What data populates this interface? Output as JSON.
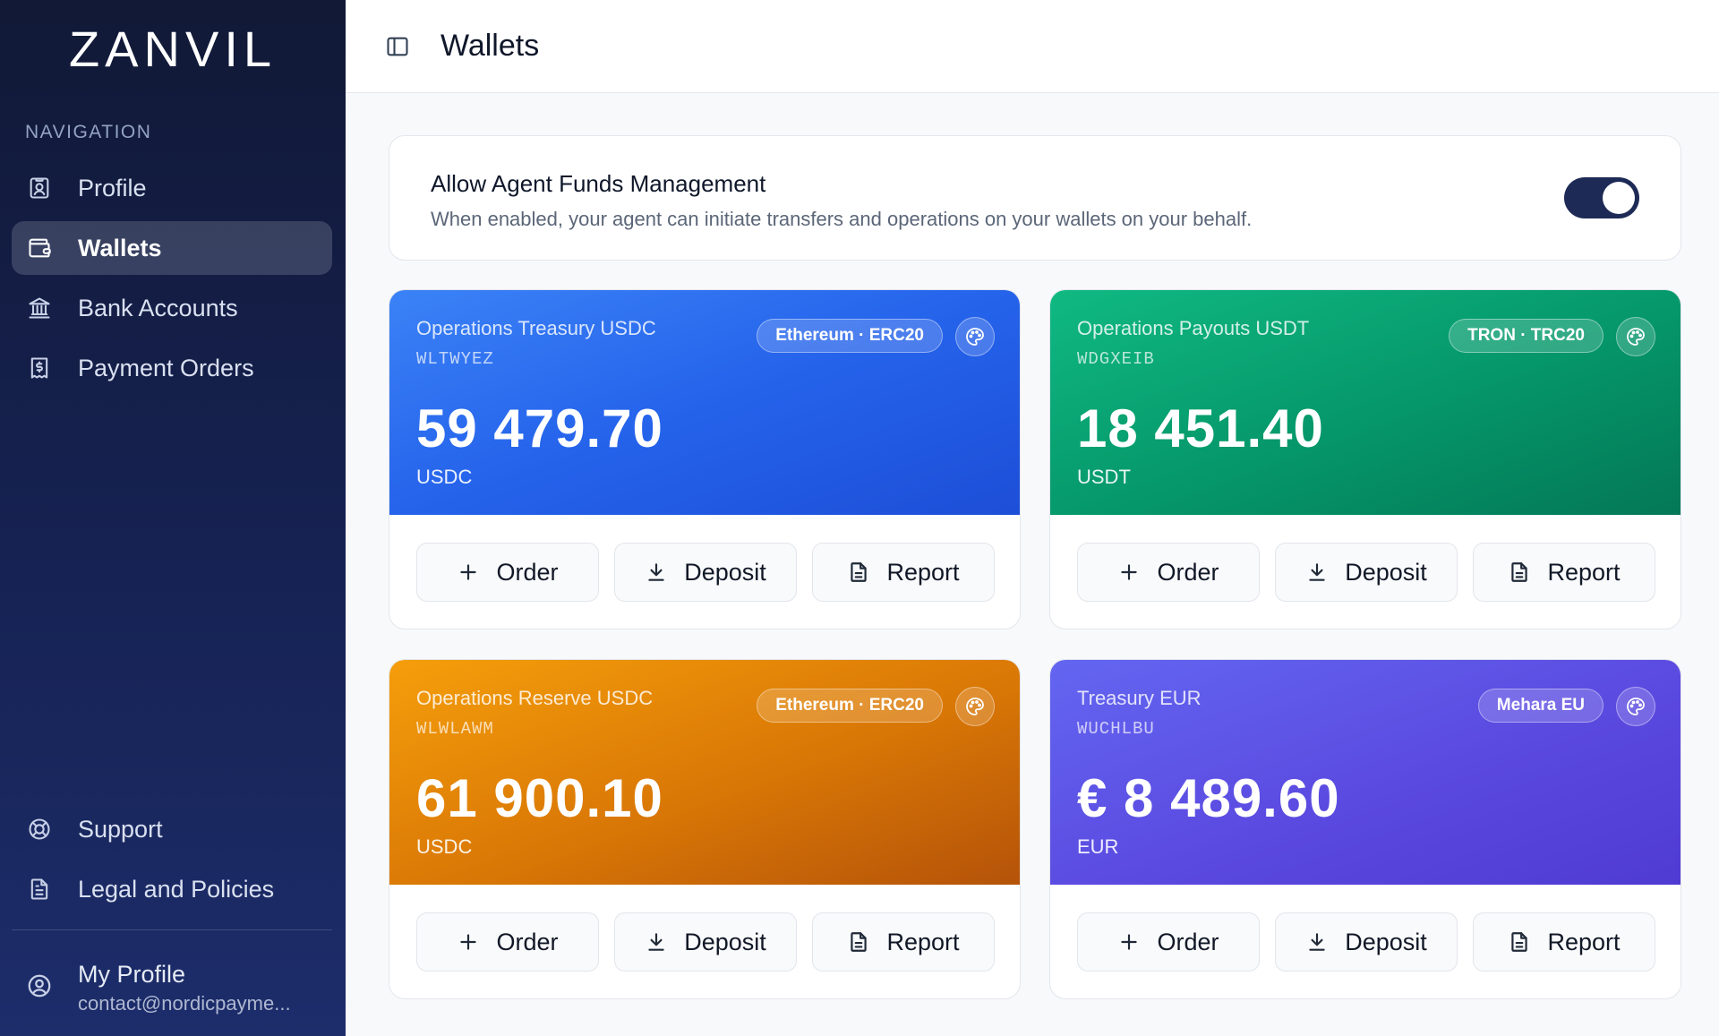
{
  "brand": {
    "logo_text": "ZANVIL"
  },
  "sidebar": {
    "section_label": "NAVIGATION",
    "items": [
      {
        "label": "Profile",
        "icon": "contact-card-icon"
      },
      {
        "label": "Wallets",
        "icon": "wallet-icon",
        "active": true
      },
      {
        "label": "Bank Accounts",
        "icon": "bank-icon"
      },
      {
        "label": "Payment Orders",
        "icon": "receipt-icon"
      }
    ],
    "bottom_items": [
      {
        "label": "Support",
        "icon": "lifebuoy-icon"
      },
      {
        "label": "Legal and Policies",
        "icon": "document-icon"
      }
    ],
    "profile": {
      "name": "My Profile",
      "email": "contact@nordicpayme..."
    }
  },
  "header": {
    "title": "Wallets"
  },
  "agent": {
    "title": "Allow Agent Funds Management",
    "description": "When enabled, your agent can initiate transfers and operations on your wallets on your behalf.",
    "enabled": true
  },
  "wallets": [
    {
      "name": "Operations Treasury USDC",
      "code": "WLTWYEZ",
      "amount": "59 479.70",
      "currency": "USDC",
      "network": "Ethereum · ERC20",
      "color": "#2563eb"
    },
    {
      "name": "Operations Payouts USDT",
      "code": "WDGXEIB",
      "amount": "18 451.40",
      "currency": "USDT",
      "network": "TRON · TRC20",
      "color": "#059669"
    },
    {
      "name": "Operations Reserve USDC",
      "code": "WLWLAWM",
      "amount": "61 900.10",
      "currency": "USDC",
      "network": "Ethereum · ERC20",
      "color": "#d97706"
    },
    {
      "name": "Treasury EUR",
      "code": "WUCHLBU",
      "amount": "€ 8 489.60",
      "currency": "EUR",
      "network": "Mehara EU",
      "color": "#5b4ae0"
    }
  ],
  "actions": {
    "order": "Order",
    "deposit": "Deposit",
    "report": "Report"
  }
}
